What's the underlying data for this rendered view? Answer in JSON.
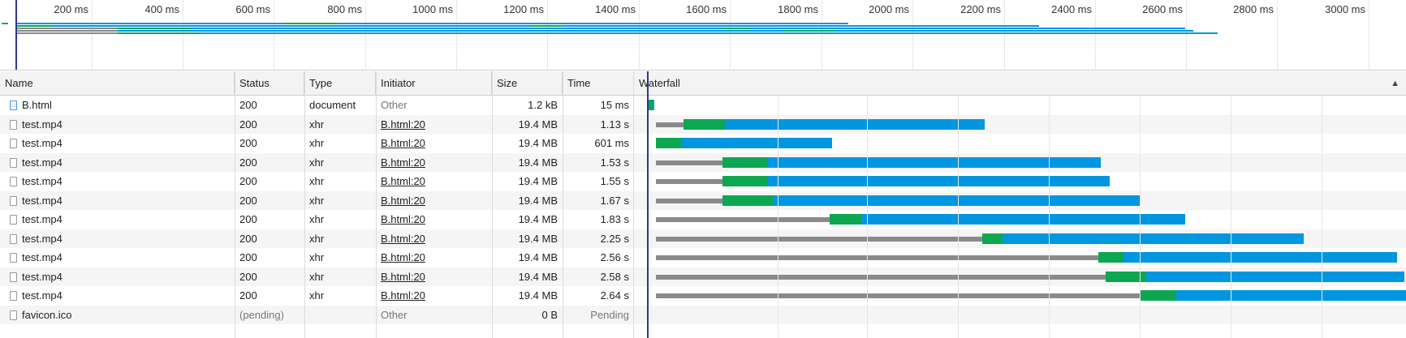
{
  "overview": {
    "ticks": [
      "200 ms",
      "400 ms",
      "600 ms",
      "800 ms",
      "1000 ms",
      "1200 ms",
      "1400 ms",
      "1600 ms",
      "1800 ms",
      "2000 ms",
      "2200 ms",
      "2400 ms",
      "2600 ms",
      "2800 ms",
      "3000 ms"
    ]
  },
  "columns": {
    "name": "Name",
    "status": "Status",
    "type": "Type",
    "initiator": "Initiator",
    "size": "Size",
    "time": "Time",
    "waterfall": "Waterfall"
  },
  "colors": {
    "waiting": "#8a8a8a",
    "ttfb": "#0ca750",
    "download": "#0096e0",
    "cursor": "#2b3a8f"
  },
  "requests": [
    {
      "name": "B.html",
      "status": "200",
      "type": "document",
      "initiator": "Other",
      "size": "1.2 kB",
      "time": "15 ms",
      "icon": "document-icon",
      "timing_ms": {
        "start": 4,
        "wait": 0,
        "ttfb": 8,
        "download": 4
      }
    },
    {
      "name": "test.mp4",
      "status": "200",
      "type": "xhr",
      "initiator": "B.html:20",
      "size": "19.4 MB",
      "time": "1.13 s",
      "icon": "file-icon",
      "timing_ms": {
        "start": 20,
        "wait": 60,
        "ttfb": 90,
        "download": 570
      }
    },
    {
      "name": "test.mp4",
      "status": "200",
      "type": "xhr",
      "initiator": "B.html:20",
      "size": "19.4 MB",
      "time": "601 ms",
      "icon": "file-icon",
      "timing_ms": {
        "start": 20,
        "wait": 0,
        "ttfb": 55,
        "download": 330
      }
    },
    {
      "name": "test.mp4",
      "status": "200",
      "type": "xhr",
      "initiator": "B.html:20",
      "size": "19.4 MB",
      "time": "1.53 s",
      "icon": "file-icon",
      "timing_ms": {
        "start": 20,
        "wait": 145,
        "ttfb": 100,
        "download": 730
      }
    },
    {
      "name": "test.mp4",
      "status": "200",
      "type": "xhr",
      "initiator": "B.html:20",
      "size": "19.4 MB",
      "time": "1.55 s",
      "icon": "file-icon",
      "timing_ms": {
        "start": 20,
        "wait": 145,
        "ttfb": 100,
        "download": 750
      }
    },
    {
      "name": "test.mp4",
      "status": "200",
      "type": "xhr",
      "initiator": "B.html:20",
      "size": "19.4 MB",
      "time": "1.67 s",
      "icon": "file-icon",
      "timing_ms": {
        "start": 20,
        "wait": 145,
        "ttfb": 110,
        "download": 805
      }
    },
    {
      "name": "test.mp4",
      "status": "200",
      "type": "xhr",
      "initiator": "B.html:20",
      "size": "19.4 MB",
      "time": "1.83 s",
      "icon": "file-icon",
      "timing_ms": {
        "start": 20,
        "wait": 380,
        "ttfb": 70,
        "download": 710
      }
    },
    {
      "name": "test.mp4",
      "status": "200",
      "type": "xhr",
      "initiator": "B.html:20",
      "size": "19.4 MB",
      "time": "2.25 s",
      "icon": "file-icon",
      "timing_ms": {
        "start": 20,
        "wait": 715,
        "ttfb": 45,
        "download": 660
      }
    },
    {
      "name": "test.mp4",
      "status": "200",
      "type": "xhr",
      "initiator": "B.html:20",
      "size": "19.4 MB",
      "time": "2.56 s",
      "icon": "file-icon",
      "timing_ms": {
        "start": 20,
        "wait": 970,
        "ttfb": 55,
        "download": 600
      }
    },
    {
      "name": "test.mp4",
      "status": "200",
      "type": "xhr",
      "initiator": "B.html:20",
      "size": "19.4 MB",
      "time": "2.58 s",
      "icon": "file-icon",
      "timing_ms": {
        "start": 20,
        "wait": 985,
        "ttfb": 90,
        "download": 565
      }
    },
    {
      "name": "test.mp4",
      "status": "200",
      "type": "xhr",
      "initiator": "B.html:20",
      "size": "19.4 MB",
      "time": "2.64 s",
      "icon": "file-icon",
      "timing_ms": {
        "start": 20,
        "wait": 1060,
        "ttfb": 80,
        "download": 600
      }
    },
    {
      "name": "favicon.ico",
      "status": "(pending)",
      "type": "",
      "initiator": "Other",
      "size": "0 B",
      "time": "Pending",
      "icon": "file-icon",
      "timing_ms": null
    }
  ]
}
